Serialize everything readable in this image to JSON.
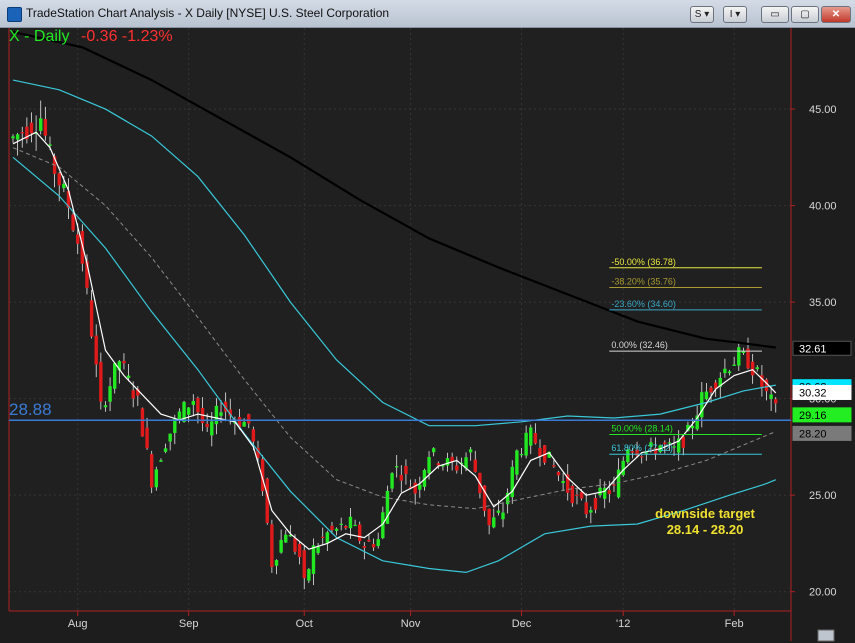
{
  "window": {
    "title": "TradeStation Chart Analysis - X Daily [NYSE] U.S. Steel Corporation",
    "buttons": {
      "s": "S ▾",
      "i": "I ▾",
      "min": "▭",
      "max": "▢",
      "close": "✕"
    }
  },
  "header": {
    "symbol": "X - Daily",
    "change": "-0.36  -1.23%"
  },
  "level_label": "28.88",
  "annotation": {
    "line1": "downside target",
    "line2": "28.14 - 28.20"
  },
  "colors": {
    "background": "#1d1d1d",
    "up_bar": "#22e822",
    "down_bar": "#e01a1a",
    "ma_long": "#000000",
    "ma_bands": "#39c8d9",
    "ma_fast": "#ffffff",
    "level_line": "#3a7bd5",
    "fib_main": "#e8e840"
  },
  "chart_data": {
    "type": "candlestick",
    "ylim": [
      19.0,
      49.2
    ],
    "y_ticks": [
      {
        "v": 20.0,
        "label": "20.00"
      },
      {
        "v": 25.0,
        "label": "25.00"
      },
      {
        "v": 30.0,
        "label": "30.00"
      },
      {
        "v": 35.0,
        "label": "35.00"
      },
      {
        "v": 40.0,
        "label": "40.00"
      },
      {
        "v": 45.0,
        "label": "45.00"
      }
    ],
    "x_ticks": [
      {
        "i": 14,
        "label": "Aug"
      },
      {
        "i": 38,
        "label": "Sep"
      },
      {
        "i": 63,
        "label": "Oct"
      },
      {
        "i": 86,
        "label": "Nov"
      },
      {
        "i": 110,
        "label": "Dec"
      },
      {
        "i": 132,
        "label": "'12"
      },
      {
        "i": 156,
        "label": "Feb"
      }
    ],
    "n_bars": 168,
    "price_path": [
      [
        0,
        43.5
      ],
      [
        6,
        44.6
      ],
      [
        8,
        42.5
      ],
      [
        12,
        40.0
      ],
      [
        15,
        37.2
      ],
      [
        17,
        33.5
      ],
      [
        19,
        29.5
      ],
      [
        23,
        32.0
      ],
      [
        27,
        29.8
      ],
      [
        30,
        25.8
      ],
      [
        33,
        27.8
      ],
      [
        36,
        29.2
      ],
      [
        39,
        30.0
      ],
      [
        42,
        28.1
      ],
      [
        45,
        29.7
      ],
      [
        48,
        28.9
      ],
      [
        51,
        28.7
      ],
      [
        54,
        25.5
      ],
      [
        56,
        21.5
      ],
      [
        59,
        23.2
      ],
      [
        62,
        21.8
      ],
      [
        63,
        20.3
      ],
      [
        65,
        22.2
      ],
      [
        68,
        23.0
      ],
      [
        73,
        23.5
      ],
      [
        76,
        22.4
      ],
      [
        79,
        22.7
      ],
      [
        82,
        26.5
      ],
      [
        84,
        26.2
      ],
      [
        87,
        25.2
      ],
      [
        90,
        27.2
      ],
      [
        93,
        26.7
      ],
      [
        96,
        26.5
      ],
      [
        99,
        27.2
      ],
      [
        103,
        23.4
      ],
      [
        106,
        24.2
      ],
      [
        109,
        27.2
      ],
      [
        112,
        28.1
      ],
      [
        116,
        26.8
      ],
      [
        120,
        25.3
      ],
      [
        124,
        24.2
      ],
      [
        128,
        25.2
      ],
      [
        130,
        25.3
      ],
      [
        133,
        27.6
      ],
      [
        137,
        27.2
      ],
      [
        140,
        27.6
      ],
      [
        143,
        27.3
      ],
      [
        146,
        28.2
      ],
      [
        149,
        30.0
      ],
      [
        152,
        31.0
      ],
      [
        155,
        31.8
      ],
      [
        157,
        32.2
      ],
      [
        159,
        32.0
      ],
      [
        161,
        31.2
      ],
      [
        163,
        30.2
      ],
      [
        164,
        29.8
      ],
      [
        165,
        29.35
      ]
    ],
    "overlays": [
      {
        "name": "MA200",
        "color": "#000000",
        "width": 2.2,
        "points": [
          [
            0,
            49.0
          ],
          [
            15,
            48.2
          ],
          [
            30,
            46.5
          ],
          [
            45,
            44.5
          ],
          [
            60,
            42.5
          ],
          [
            75,
            40.3
          ],
          [
            90,
            38.3
          ],
          [
            105,
            36.8
          ],
          [
            120,
            35.4
          ],
          [
            135,
            34.0
          ],
          [
            150,
            33.1
          ],
          [
            157,
            32.9
          ],
          [
            165,
            32.65
          ]
        ]
      },
      {
        "name": "MA-upper",
        "color": "#39c8d9",
        "width": 1.2,
        "points": [
          [
            0,
            46.5
          ],
          [
            10,
            46.0
          ],
          [
            20,
            45.0
          ],
          [
            30,
            43.6
          ],
          [
            40,
            41.5
          ],
          [
            50,
            38.5
          ],
          [
            60,
            35.0
          ],
          [
            70,
            32.0
          ],
          [
            80,
            29.8
          ],
          [
            90,
            28.6
          ],
          [
            100,
            28.6
          ],
          [
            110,
            28.8
          ],
          [
            120,
            29.1
          ],
          [
            130,
            29.0
          ],
          [
            140,
            29.2
          ],
          [
            150,
            29.8
          ],
          [
            158,
            30.4
          ],
          [
            165,
            30.7
          ]
        ]
      },
      {
        "name": "MA-lower",
        "color": "#39c8d9",
        "width": 1.2,
        "points": [
          [
            0,
            42.5
          ],
          [
            10,
            40.5
          ],
          [
            20,
            37.8
          ],
          [
            30,
            34.5
          ],
          [
            40,
            31.5
          ],
          [
            50,
            28.2
          ],
          [
            60,
            25.2
          ],
          [
            70,
            22.8
          ],
          [
            80,
            21.6
          ],
          [
            90,
            21.2
          ],
          [
            98,
            21.0
          ],
          [
            105,
            21.6
          ],
          [
            115,
            23.0
          ],
          [
            125,
            23.4
          ],
          [
            135,
            23.5
          ],
          [
            145,
            24.2
          ],
          [
            155,
            25.0
          ],
          [
            163,
            25.6
          ],
          [
            165,
            25.8
          ]
        ]
      },
      {
        "name": "MA-mid",
        "color": "#8a8a8a",
        "width": 1.0,
        "dash": "4,3",
        "points": [
          [
            0,
            43.0
          ],
          [
            10,
            42.0
          ],
          [
            20,
            40.0
          ],
          [
            30,
            37.3
          ],
          [
            40,
            34.2
          ],
          [
            50,
            31.0
          ],
          [
            60,
            28.0
          ],
          [
            70,
            25.8
          ],
          [
            80,
            24.9
          ],
          [
            90,
            24.5
          ],
          [
            100,
            24.3
          ],
          [
            110,
            24.8
          ],
          [
            120,
            25.3
          ],
          [
            130,
            25.6
          ],
          [
            140,
            26.1
          ],
          [
            150,
            26.8
          ],
          [
            158,
            27.6
          ],
          [
            165,
            28.3
          ]
        ]
      },
      {
        "name": "MA-fast",
        "color": "#ffffff",
        "width": 1.2,
        "points": [
          [
            0,
            43.2
          ],
          [
            5,
            43.8
          ],
          [
            8,
            43.0
          ],
          [
            12,
            40.8
          ],
          [
            16,
            37.0
          ],
          [
            20,
            32.5
          ],
          [
            24,
            31.2
          ],
          [
            28,
            30.2
          ],
          [
            32,
            29.2
          ],
          [
            36,
            28.9
          ],
          [
            40,
            29.2
          ],
          [
            44,
            29.0
          ],
          [
            48,
            28.8
          ],
          [
            52,
            27.5
          ],
          [
            56,
            24.2
          ],
          [
            60,
            23.0
          ],
          [
            64,
            22.2
          ],
          [
            68,
            22.5
          ],
          [
            72,
            23.0
          ],
          [
            76,
            22.8
          ],
          [
            80,
            23.5
          ],
          [
            84,
            25.1
          ],
          [
            88,
            25.6
          ],
          [
            92,
            26.5
          ],
          [
            96,
            26.8
          ],
          [
            100,
            26.0
          ],
          [
            104,
            24.4
          ],
          [
            108,
            25.2
          ],
          [
            112,
            26.8
          ],
          [
            116,
            27.2
          ],
          [
            120,
            25.9
          ],
          [
            124,
            25.0
          ],
          [
            128,
            25.2
          ],
          [
            132,
            26.3
          ],
          [
            136,
            27.2
          ],
          [
            140,
            27.4
          ],
          [
            144,
            27.8
          ],
          [
            148,
            29.0
          ],
          [
            152,
            30.5
          ],
          [
            156,
            31.2
          ],
          [
            160,
            31.5
          ],
          [
            163,
            30.8
          ],
          [
            165,
            30.3
          ]
        ]
      }
    ],
    "horizontal_levels": [
      {
        "name": "level-28.88",
        "v": 28.88,
        "color": "#3a7bd5",
        "x_from": 0,
        "x_to": 168,
        "width": 1.5
      }
    ],
    "fibonacci": [
      {
        "v": 36.78,
        "label": "-50.00% (36.78)",
        "color": "#e8e840",
        "opacity": 1.0
      },
      {
        "v": 35.76,
        "label": "-38.20% (35.76)",
        "color": "#a89a30",
        "opacity": 1.0
      },
      {
        "v": 34.6,
        "label": "-23.60% (34.60)",
        "color": "#3aa8c8",
        "opacity": 1.0
      },
      {
        "v": 32.46,
        "label": "0.00% (32.46)",
        "color": "#d8d8d8",
        "opacity": 1.0
      },
      {
        "v": 28.14,
        "label": "50.00% (28.14)",
        "color": "#22e822",
        "opacity": 1.0
      },
      {
        "v": 27.12,
        "label": "61.80% (27.12)",
        "color": "#39c8d9",
        "opacity": 1.0
      }
    ],
    "fib_x_from": 129,
    "fib_x_to": 162,
    "price_tags": [
      {
        "v": 32.61,
        "label": "32.61",
        "bg": "#000000",
        "fg": "#ffffff",
        "border": "#555555"
      },
      {
        "v": 30.62,
        "label": "30.62",
        "bg": "#00e5ff",
        "fg": "#000000",
        "border": "#00e5ff"
      },
      {
        "v": 30.32,
        "label": "30.32",
        "bg": "#ffffff",
        "fg": "#000000",
        "border": "#ffffff"
      },
      {
        "v": 29.16,
        "label": "29.16",
        "bg": "#22ee22",
        "fg": "#000000",
        "border": "#22ee22"
      },
      {
        "v": 28.2,
        "label": "28.20",
        "bg": "#7a7a7a",
        "fg": "#000000",
        "border": "#7a7a7a"
      }
    ]
  }
}
